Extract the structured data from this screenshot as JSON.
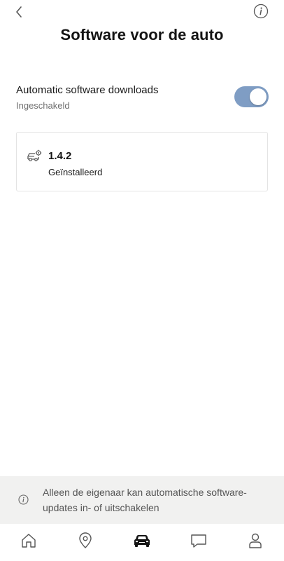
{
  "header": {
    "title": "Software voor de auto",
    "back_icon": "chevron-left-icon",
    "info_icon": "info-icon"
  },
  "setting": {
    "label": "Automatic software downloads",
    "status": "Ingeschakeld",
    "toggle_on": true,
    "toggle_color": "#7f9dc4"
  },
  "version": {
    "icon": "car-settings-icon",
    "number": "1.4.2",
    "status": "Geïnstalleerd"
  },
  "notice": {
    "icon": "info-icon",
    "text": "Alleen de eigenaar kan automatische software-updates in- of uitschakelen"
  },
  "nav": {
    "items": [
      {
        "name": "home",
        "icon": "home-icon"
      },
      {
        "name": "map",
        "icon": "location-pin-icon"
      },
      {
        "name": "car",
        "icon": "car-icon",
        "active": true
      },
      {
        "name": "messages",
        "icon": "chat-bubble-icon"
      },
      {
        "name": "profile",
        "icon": "person-icon"
      }
    ]
  }
}
